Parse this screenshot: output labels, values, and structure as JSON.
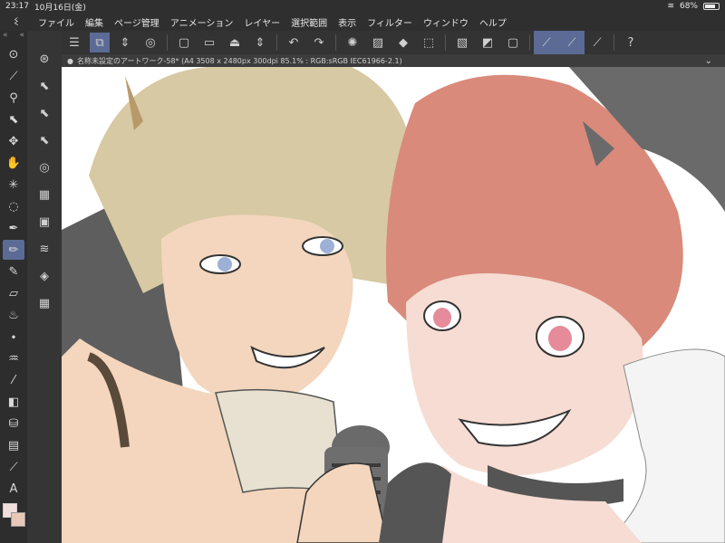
{
  "status": {
    "time": "23:17",
    "date": "10月16日(金)",
    "battery": "68%",
    "wifi_icon": "wifi-icon"
  },
  "menu": [
    "ファイル",
    "編集",
    "ページ管理",
    "アニメーション",
    "レイヤー",
    "選択範囲",
    "表示",
    "フィルター",
    "ウィンドウ",
    "ヘルプ"
  ],
  "document": {
    "tab_title": "名称未設定のアートワーク-58* (A4 3508 x 2480px 300dpi 85.1% : RGB:sRGB IEC61966-2.1)"
  },
  "colors": {
    "accent": "#5b6b95",
    "foreground": "#f3dede",
    "background": "#e8c8b8"
  },
  "icons": {
    "toolbar": [
      "hamburger-icon",
      "layer-settings-icon",
      "stepper-icon",
      "spiral-icon",
      "new-icon",
      "open-icon",
      "save-icon",
      "stepper-icon",
      "undo-icon",
      "redo-icon",
      "loading-icon",
      "clear-icon",
      "fill-icon",
      "transform-icon",
      "hide-selection-icon",
      "mask-icon",
      "frame-icon",
      "pen-stabilizer-icon",
      "pen-stabilizer-2-icon",
      "pen-stabilizer-3-icon",
      "help-icon"
    ],
    "tools": [
      "pointer-icon",
      "eyedropper-icon",
      "zoom-icon",
      "object-icon",
      "move-icon",
      "hand-icon",
      "auto-select-icon",
      "lasso-icon",
      "pen-icon",
      "pencil-icon",
      "marker-icon",
      "eraser-icon",
      "blend-icon",
      "dropper-fill-icon",
      "airbrush-icon",
      "line-icon",
      "gradient-icon",
      "fill-bucket-icon",
      "frame-border-icon",
      "ruler-icon",
      "text-icon"
    ],
    "subtools": [
      "navigator-icon",
      "layer-property-icon",
      "layer-search-icon",
      "layer-effect-icon",
      "color-circle-icon",
      "texture-icon",
      "animation-icon",
      "layers-icon",
      "layers-alt-icon",
      "grid-icon"
    ]
  }
}
